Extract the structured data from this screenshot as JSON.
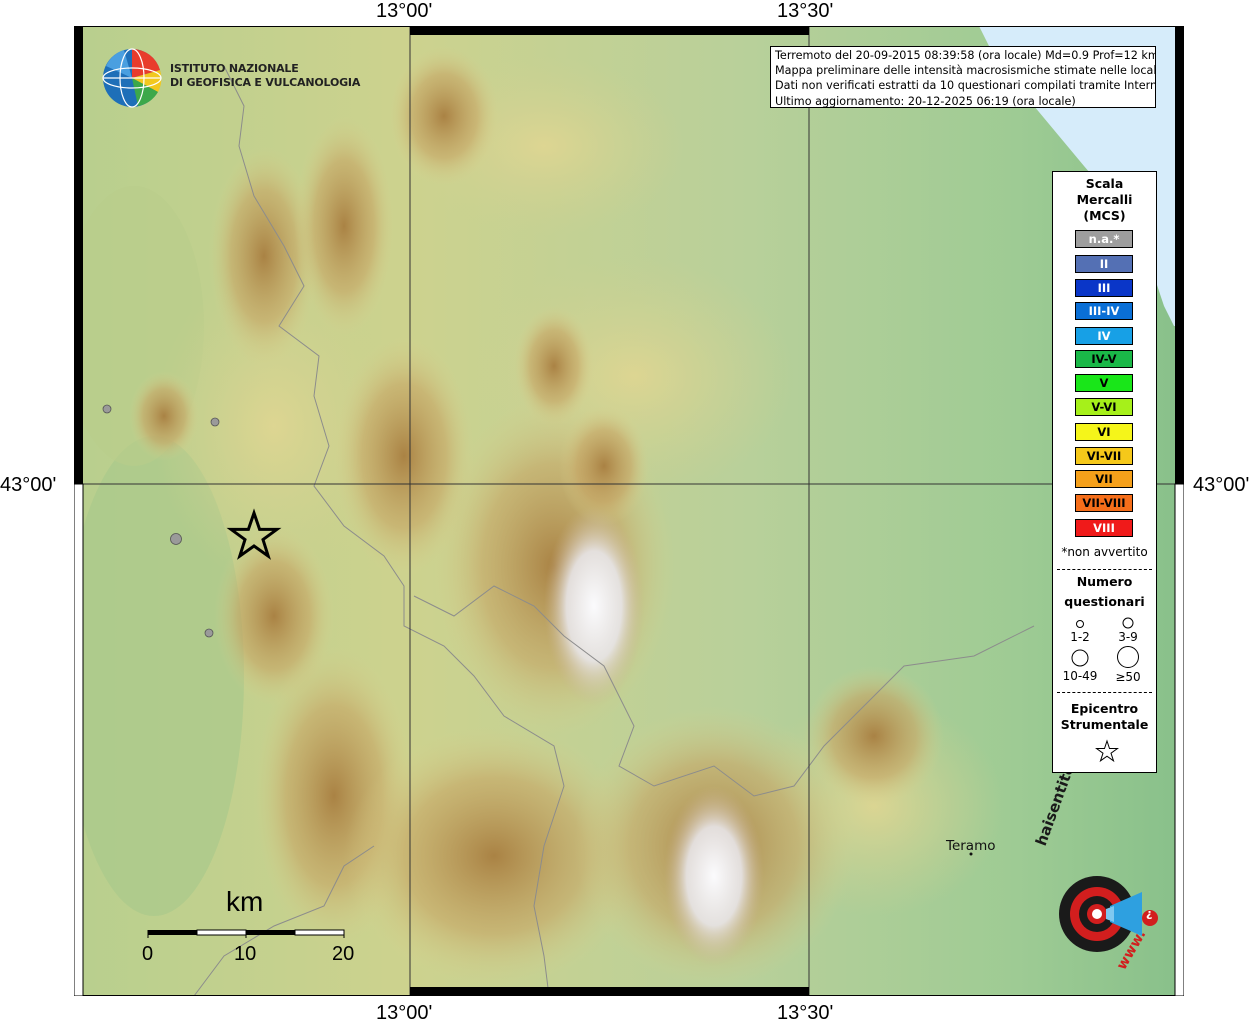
{
  "coordinates": {
    "top_left": "13°00'",
    "top_right": "13°30'",
    "bottom_left": "13°00'",
    "bottom_right": "13°30'",
    "left_lat": "43°00'",
    "right_lat": "43°00'"
  },
  "info": {
    "line1": "Terremoto del 20-09-2015 08:39:58 (ora locale) Md=0.9 Prof=12 km",
    "line2": "Mappa preliminare delle intensità macrosismiche stimate nelle località",
    "line3": "Dati non verificati estratti da 10 questionari compilati tramite Internet.",
    "line4": "Ultimo aggiornamento: 20-12-2025 06:19 (ora locale)"
  },
  "logo": {
    "line1": "ISTITUTO NAZIONALE",
    "line2": "DI GEOFISICA E VULCANOLOGIA"
  },
  "legend": {
    "title_line1": "Scala",
    "title_line2": "Mercalli",
    "title_line3": "(MCS)",
    "mcs_classes": [
      {
        "label": "n.a.*",
        "color": "#9e9e9e",
        "text": "#ffffff"
      },
      {
        "label": "II",
        "color": "#5470b4",
        "text": "#ffffff"
      },
      {
        "label": "III",
        "color": "#0a36c8",
        "text": "#ffffff"
      },
      {
        "label": "III-IV",
        "color": "#0a6fd6",
        "text": "#ffffff"
      },
      {
        "label": "IV",
        "color": "#17a0e6",
        "text": "#ffffff"
      },
      {
        "label": "IV-V",
        "color": "#1ab848",
        "text": "#000000"
      },
      {
        "label": "V",
        "color": "#19e619",
        "text": "#000000"
      },
      {
        "label": "V-VI",
        "color": "#a6f01a",
        "text": "#000000"
      },
      {
        "label": "VI",
        "color": "#f5f51a",
        "text": "#000000"
      },
      {
        "label": "VI-VII",
        "color": "#f5c81a",
        "text": "#000000"
      },
      {
        "label": "VII",
        "color": "#f5a01a",
        "text": "#000000"
      },
      {
        "label": "VII-VIII",
        "color": "#f56e1a",
        "text": "#000000"
      },
      {
        "label": "VIII",
        "color": "#f01a1a",
        "text": "#ffffff"
      }
    ],
    "not_felt_note": "*non avvertito",
    "questionnaires_line1": "Numero",
    "questionnaires_line2": "questionari",
    "q_sizes": [
      "1-2",
      "3-9",
      "10-49",
      "≥50"
    ],
    "epicenter_line1": "Epicentro",
    "epicenter_line2": "Strumentale"
  },
  "places": {
    "teramo": "Teramo"
  },
  "scale_bar": {
    "unit": "km",
    "ticks": [
      "0",
      "10",
      "20"
    ]
  },
  "badge": {
    "text_main": "haisentitoilterremoto.it",
    "text_www": "www.",
    "text_q": "?"
  },
  "colors": {
    "sea": "#d6ecfa",
    "lowland": "#9cc890",
    "hill": "#d8d48e",
    "mountain": "#b28a4a",
    "peak": "#f4f4f6",
    "epicenter_star": "#000000",
    "report_dot": "#9a9a9a"
  }
}
